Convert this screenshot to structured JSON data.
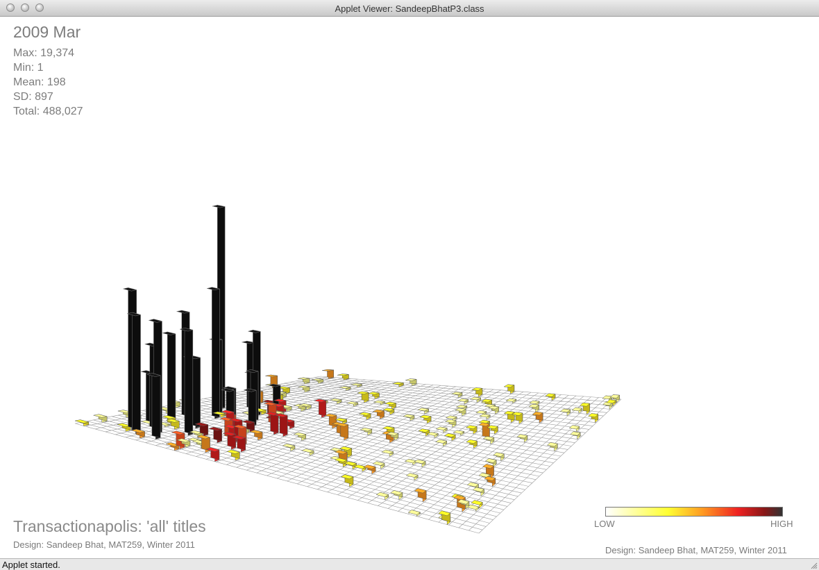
{
  "window": {
    "title": "Applet Viewer: SandeepBhatP3.class"
  },
  "view": {
    "month": "2009 Mar",
    "stats": [
      {
        "label": "Max",
        "value": "19,374"
      },
      {
        "label": "Min",
        "value": "1"
      },
      {
        "label": "Mean",
        "value": "198"
      },
      {
        "label": "SD",
        "value": "897"
      },
      {
        "label": "Total",
        "value": "488,027"
      }
    ],
    "title": "Transactionapolis: 'all' titles",
    "credit": "Design: Sandeep Bhat, MAT259, Winter 2011"
  },
  "legend": {
    "low": "LOW",
    "high": "HIGH",
    "colors": [
      "#ffffff",
      "#ffff33",
      "#ff9922",
      "#ee2222",
      "#881818",
      "#333333"
    ]
  },
  "status": {
    "text": "Applet started."
  }
}
